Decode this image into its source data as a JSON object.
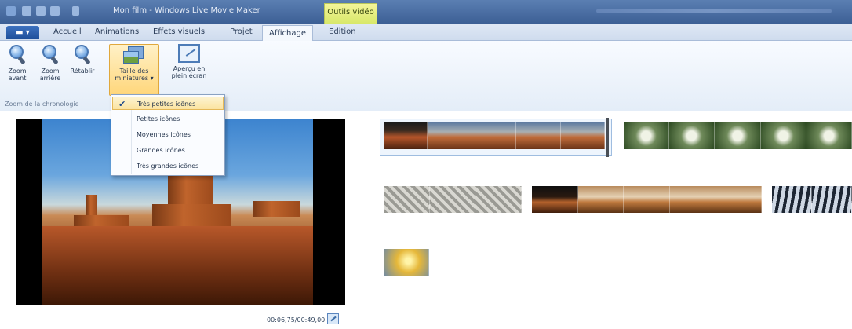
{
  "window": {
    "title": "Mon film - Windows Live Movie Maker",
    "contextual_tab": "Outils vidéo"
  },
  "ribbon_tabs": {
    "file_label": "",
    "tabs": [
      "Accueil",
      "Animations",
      "Effets visuels",
      "Projet",
      "Affichage",
      "Edition"
    ],
    "active": "Affichage"
  },
  "ribbon": {
    "zoom_in": "Zoom\navant",
    "zoom_out": "Zoom\narrière",
    "reset": "Rétablir",
    "thumb_size": "Taille des\nminiatures ▾",
    "fullscreen_preview": "Aperçu en\nplein écran",
    "group_label": "Zoom de la chronologie"
  },
  "thumbnail_menu": {
    "items": [
      "Très petites icônes",
      "Petites icônes",
      "Moyennes icônes",
      "Grandes icônes",
      "Très grandes icônes"
    ],
    "selected_index": 0
  },
  "preview": {
    "time_readout": "00:06,75/00:49,00"
  },
  "icons": {
    "zoom_in": "zoom-in-icon",
    "zoom_out": "zoom-out-icon",
    "reset": "zoom-reset-icon",
    "thumb_size": "thumbnail-size-icon",
    "fullscreen": "fullscreen-preview-icon",
    "expand": "expand-icon",
    "check": "checkmark-icon"
  },
  "colors": {
    "title_bar": "#3c5f95",
    "contextual_tab": "#d8e86a",
    "selection": "#fbe3a0"
  }
}
